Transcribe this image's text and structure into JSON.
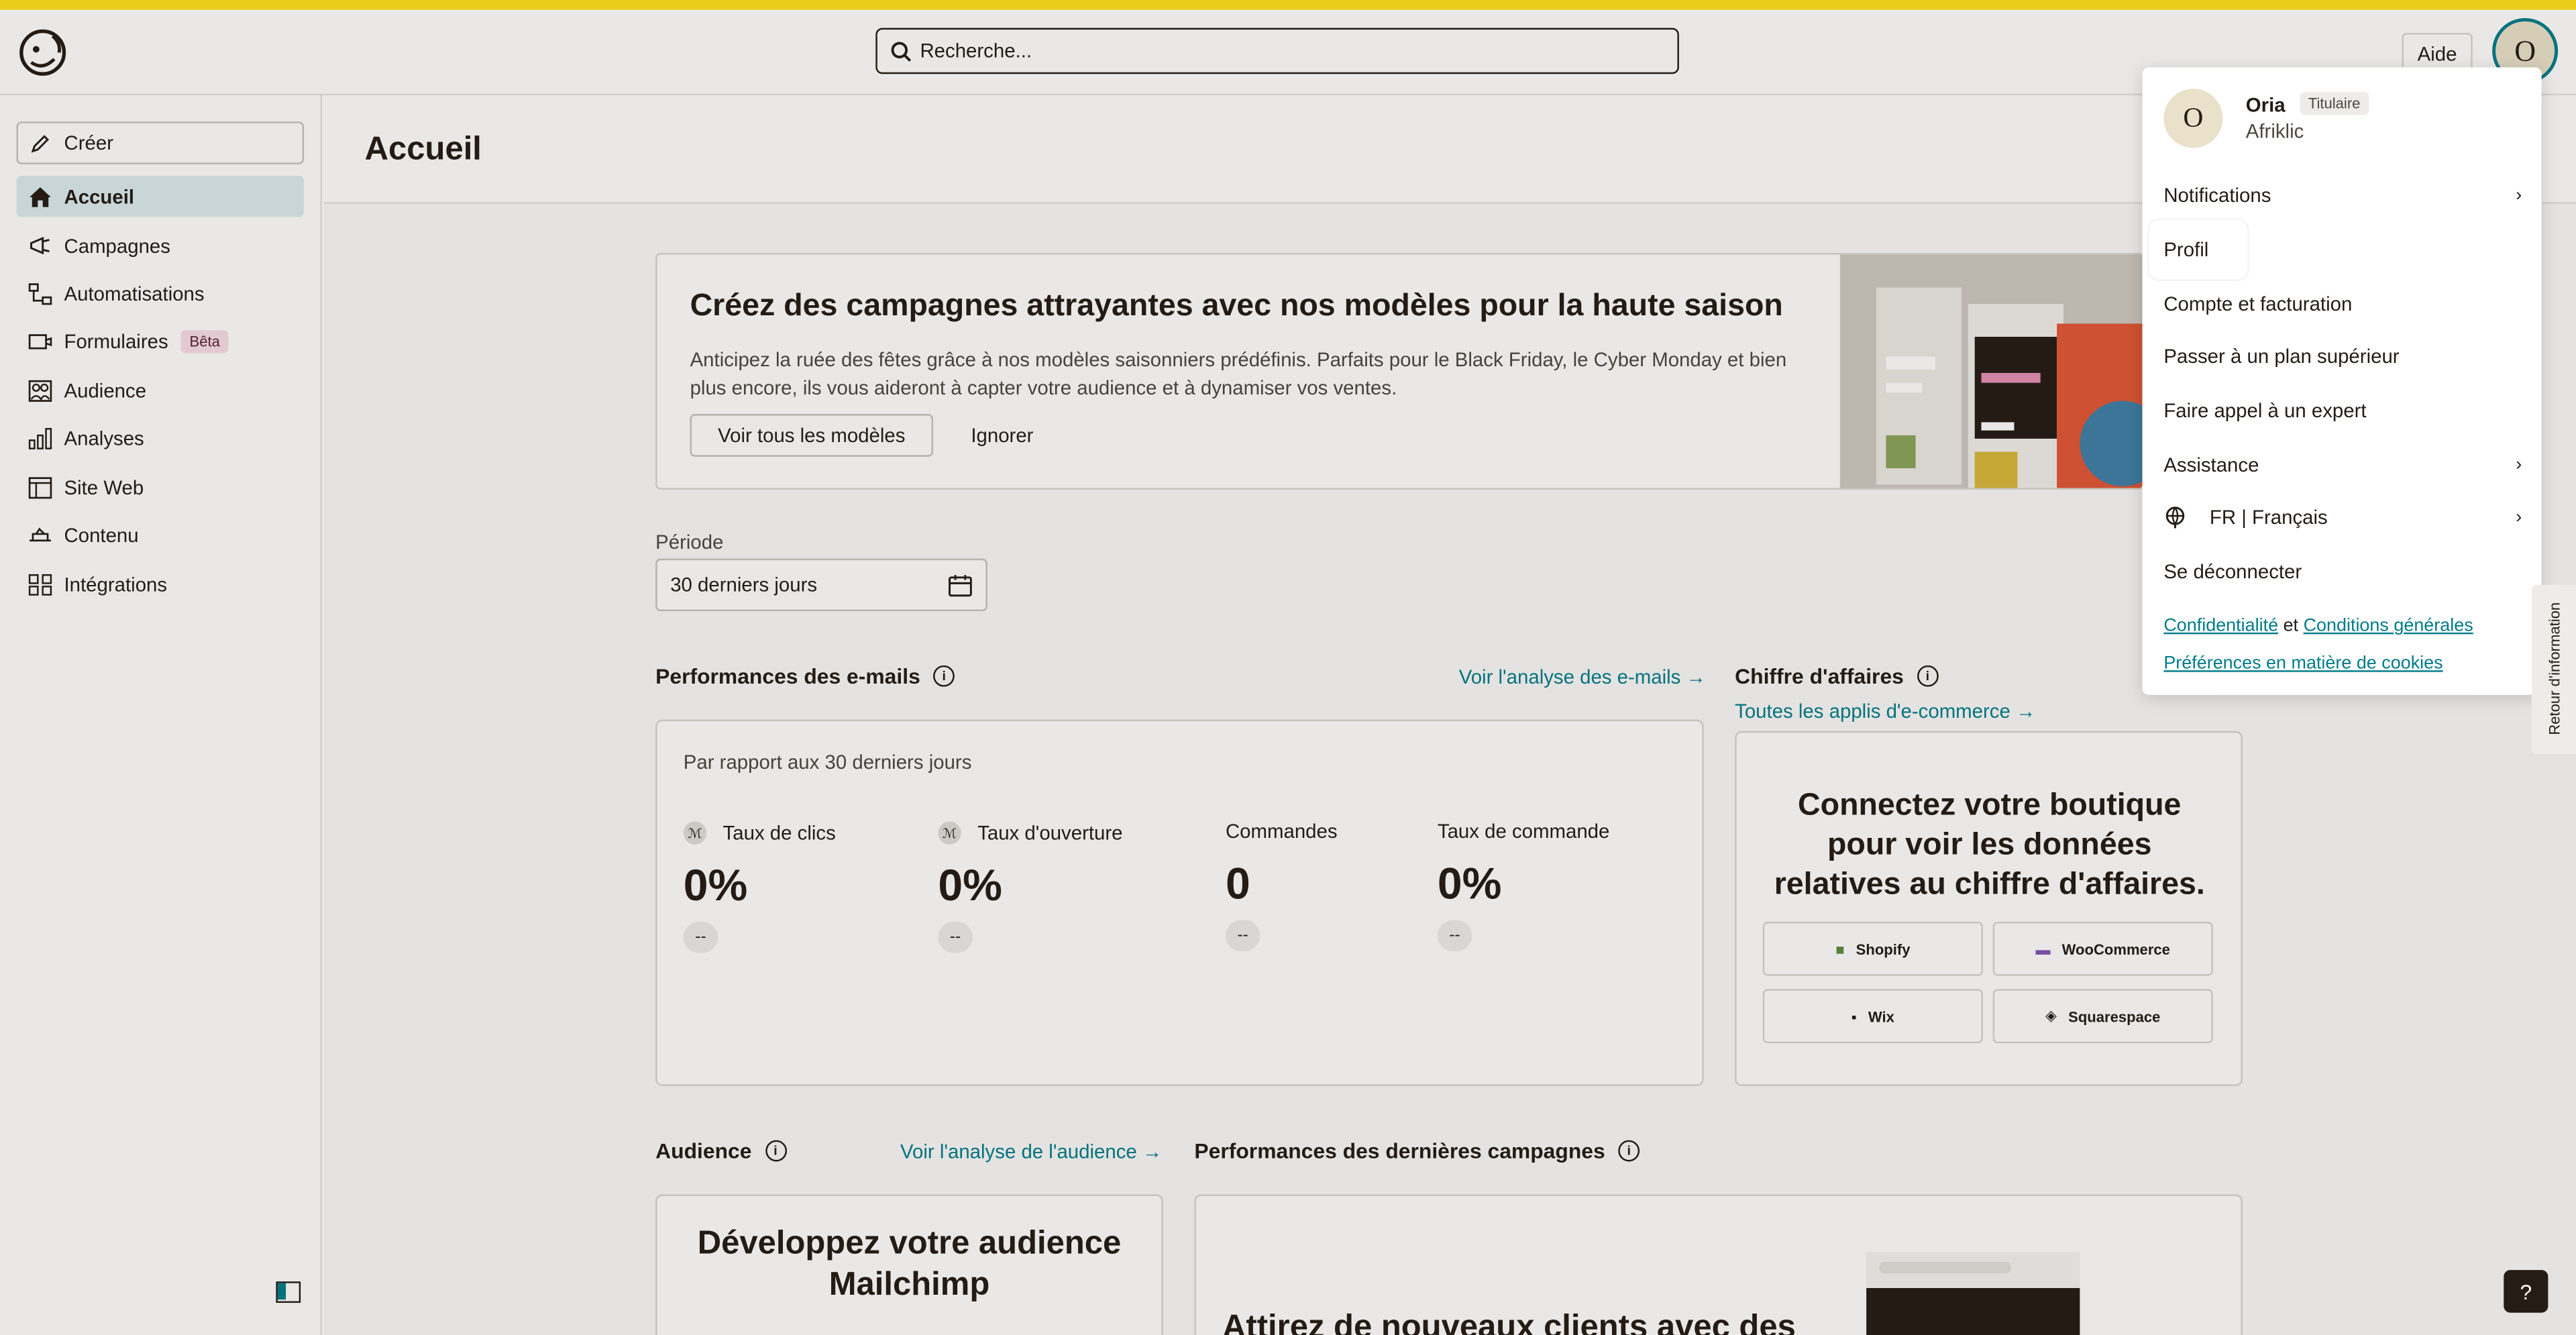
{
  "header": {
    "search_placeholder": "Recherche...",
    "help_label": "Aide",
    "avatar_initial": "O"
  },
  "sidebar": {
    "create_label": "Créer",
    "items": [
      {
        "label": "Accueil",
        "icon": "home-icon",
        "active": true
      },
      {
        "label": "Campagnes",
        "icon": "megaphone-icon"
      },
      {
        "label": "Automatisations",
        "icon": "automation-icon"
      },
      {
        "label": "Formulaires",
        "icon": "form-icon",
        "badge": "Bêta"
      },
      {
        "label": "Audience",
        "icon": "audience-icon"
      },
      {
        "label": "Analyses",
        "icon": "bar-chart-icon"
      },
      {
        "label": "Site Web",
        "icon": "website-icon"
      },
      {
        "label": "Contenu",
        "icon": "content-icon"
      },
      {
        "label": "Intégrations",
        "icon": "grid-icon"
      }
    ]
  },
  "page": {
    "title": "Accueil"
  },
  "banner": {
    "title": "Créez des campagnes attrayantes avec nos modèles pour la haute saison",
    "body": "Anticipez la ruée des fêtes grâce à nos modèles saisonniers prédéfinis. Parfaits pour le Black Friday, le Cyber Monday et bien plus encore, ils vous aideront à capter votre audience et à dynamiser vos ventes.",
    "primary_label": "Voir tous les modèles",
    "secondary_label": "Ignorer"
  },
  "period": {
    "label": "Période",
    "value": "30 derniers jours"
  },
  "email_perf": {
    "title": "Performances des e-mails",
    "link": "Voir l'analyse des e-mails →",
    "subtitle": "Par rapport aux 30 derniers jours",
    "metrics": [
      {
        "label": "Taux de clics",
        "value": "0%",
        "delta": "--"
      },
      {
        "label": "Taux d'ouverture",
        "value": "0%",
        "delta": "--"
      },
      {
        "label": "Commandes",
        "value": "0",
        "delta": "--"
      },
      {
        "label": "Taux de commande",
        "value": "0%",
        "delta": "--"
      }
    ]
  },
  "revenue": {
    "title": "Chiffre d'affaires",
    "link": "Toutes les applis d'e-commerce →",
    "text": "Connectez votre boutique pour voir les données relatives au chiffre d'affaires.",
    "stores": [
      "Shopify",
      "WooCommerce",
      "Wix",
      "Squarespace"
    ]
  },
  "audience": {
    "title": "Audience",
    "link": "Voir l'analyse de l'audience →",
    "card_text": "Développez votre audience Mailchimp"
  },
  "campaigns": {
    "title": "Performances des dernières campagnes",
    "card_text": "Attirez de nouveaux clients avec des"
  },
  "dropdown": {
    "avatar_initial": "O",
    "name": "Oria",
    "role": "Titulaire",
    "org": "Afriklic",
    "items": [
      {
        "label": "Notifications",
        "chevron": true
      },
      {
        "label": "Profil"
      },
      {
        "label": "Compte et facturation"
      },
      {
        "label": "Passer à un plan supérieur"
      },
      {
        "label": "Faire appel à un expert"
      },
      {
        "label": "Assistance",
        "chevron": true
      },
      {
        "label": "FR | Français",
        "chevron": true,
        "icon": "globe-icon"
      },
      {
        "label": "Se déconnecter"
      }
    ],
    "legal_privacy": "Confidentialité",
    "legal_and": "et",
    "legal_terms": "Conditions générales",
    "legal_cookies": "Préférences en matière de cookies"
  },
  "feedback_label": "Retour d'information",
  "help_question": "?"
}
